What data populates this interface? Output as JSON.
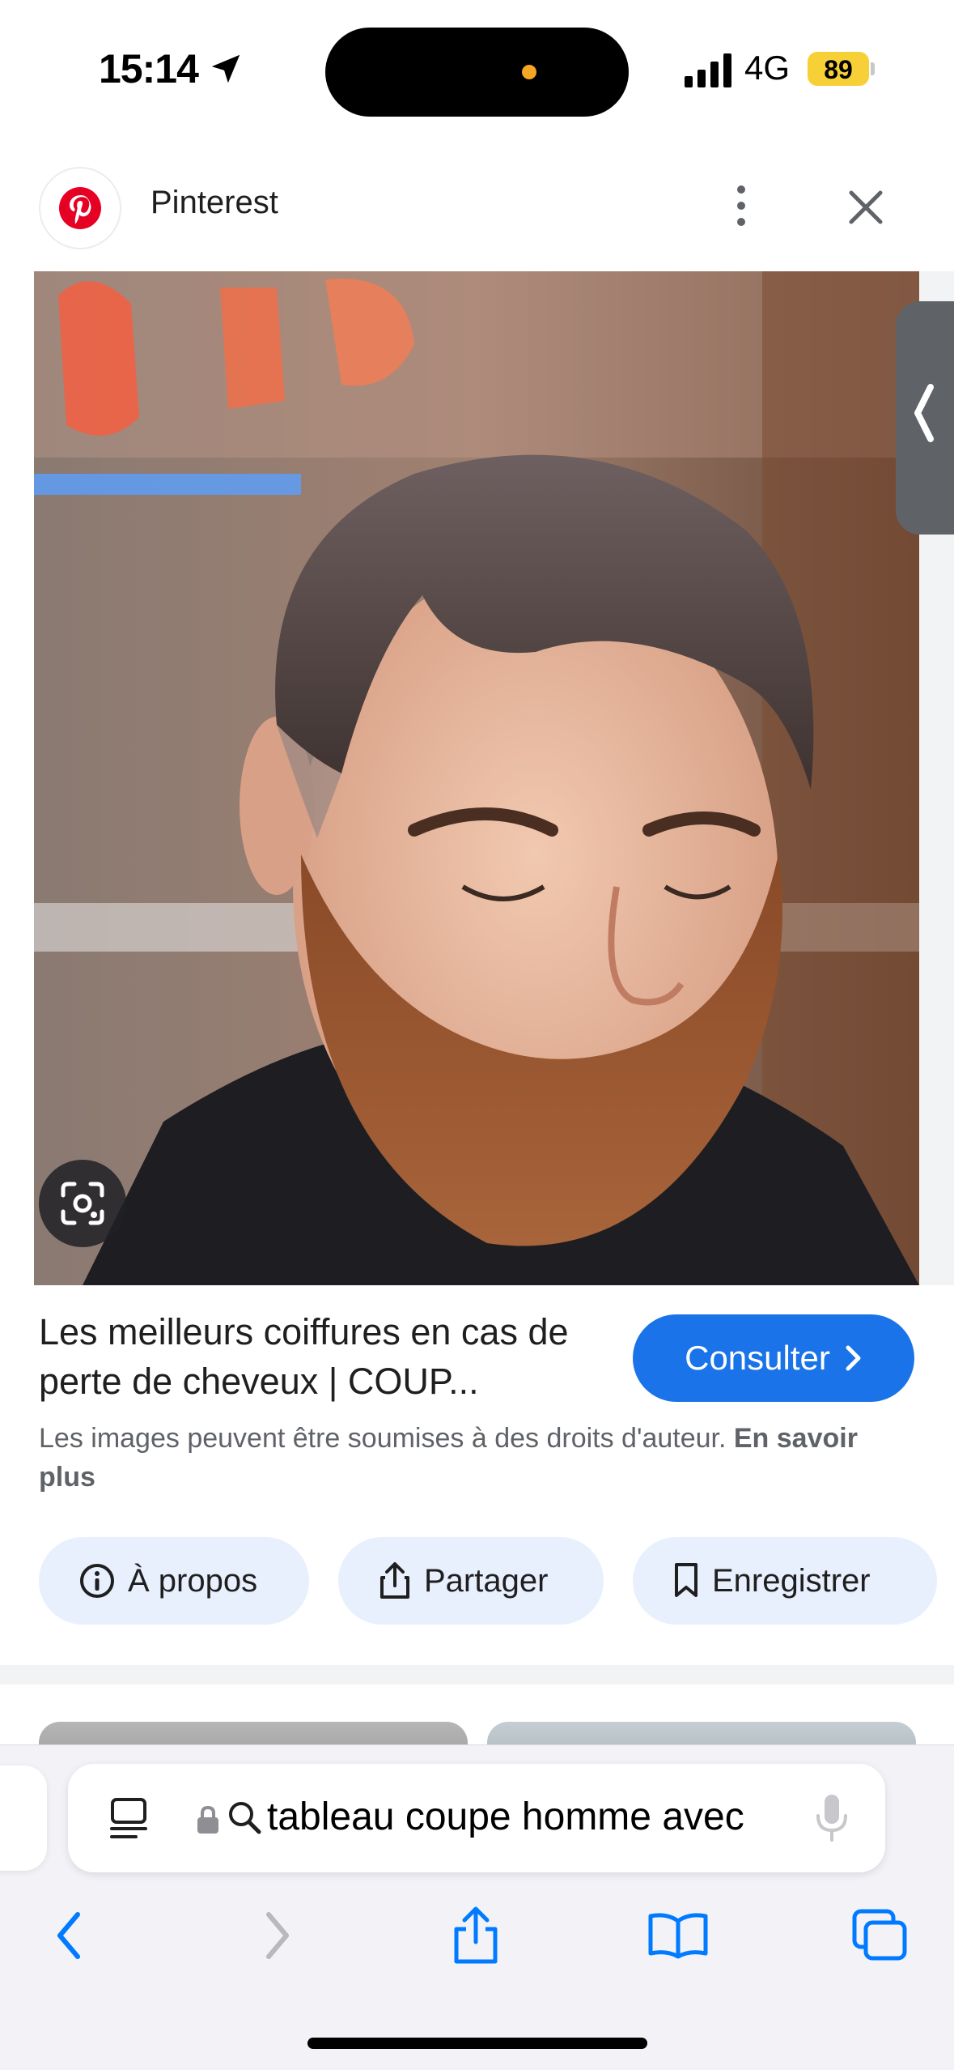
{
  "status_bar": {
    "time": "15:14",
    "network": "4G",
    "battery": "89",
    "colors": {
      "battery": "#f7d038",
      "indicator": "#f5a623"
    }
  },
  "site": {
    "name": "Pinterest",
    "brand_color": "#e60023"
  },
  "result": {
    "title": "Les meilleurs coiffures en cas de perte de cheveux | COUP...",
    "visit_label": "Consulter",
    "copyright_text": "Les images peuvent être soumises à des droits d'auteur.",
    "learn_more": "En savoir plus",
    "accent_color": "#1a73e8"
  },
  "chips": {
    "about": "À propos",
    "share": "Partager",
    "save": "Enregistrer"
  },
  "browser": {
    "query": "tableau coupe homme avec",
    "icon_color": "#007aff"
  }
}
